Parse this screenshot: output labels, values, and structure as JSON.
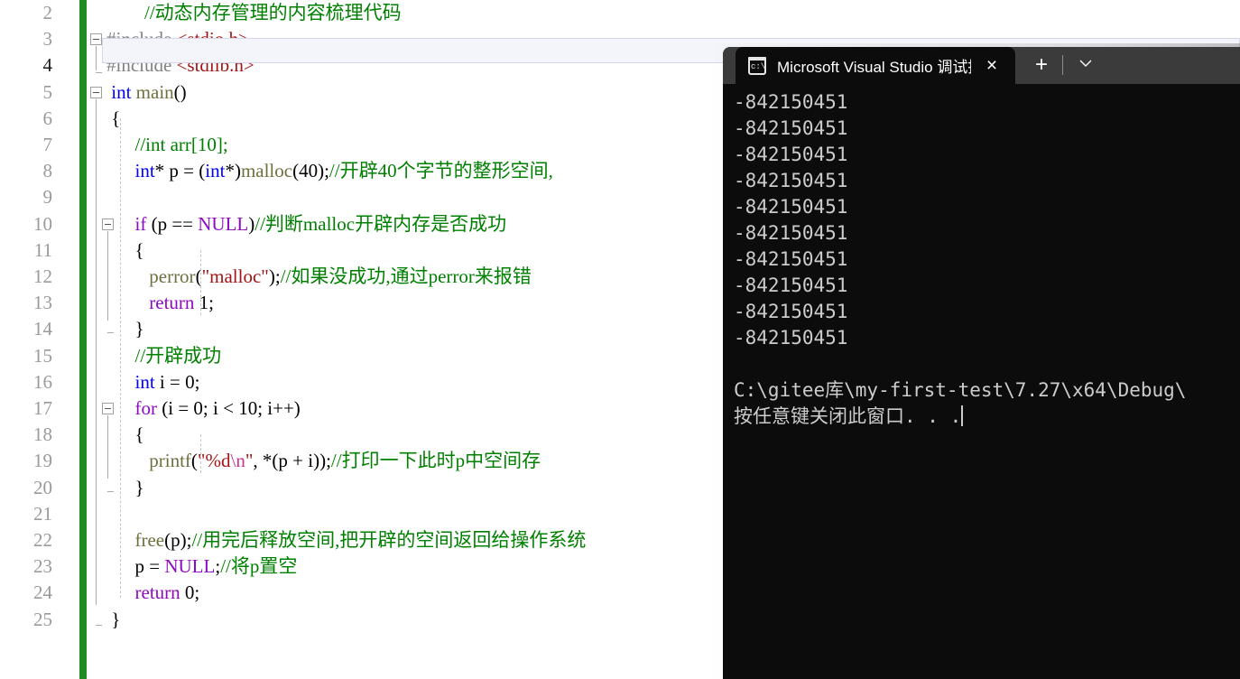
{
  "editor": {
    "name": "visual-studio-code-editor",
    "current_line": 4,
    "change_bar_color": "#1f8b23",
    "lines": [
      {
        "num": "2",
        "segs": [
          {
            "t": "        ",
            "c": "plain"
          },
          {
            "t": "//动态内存管理的内容梳理代码",
            "c": "cmt"
          }
        ]
      },
      {
        "num": "3",
        "segs": [
          {
            "t": "#include ",
            "c": "pp"
          },
          {
            "t": "<stdio.h>",
            "c": "inc"
          }
        ]
      },
      {
        "num": "4",
        "segs": [
          {
            "t": "#include ",
            "c": "pp"
          },
          {
            "t": "<stdlib.h>",
            "c": "inc"
          }
        ]
      },
      {
        "num": "5",
        "segs": [
          {
            "t": " ",
            "c": "plain"
          },
          {
            "t": "int",
            "c": "kw"
          },
          {
            "t": " ",
            "c": "plain"
          },
          {
            "t": "main",
            "c": "fn"
          },
          {
            "t": "()",
            "c": "plain"
          }
        ]
      },
      {
        "num": "6",
        "segs": [
          {
            "t": " {",
            "c": "plain"
          }
        ]
      },
      {
        "num": "7",
        "segs": [
          {
            "t": "      ",
            "c": "plain"
          },
          {
            "t": "//int arr[10];",
            "c": "cmt"
          }
        ]
      },
      {
        "num": "8",
        "segs": [
          {
            "t": "      ",
            "c": "plain"
          },
          {
            "t": "int",
            "c": "kw"
          },
          {
            "t": "* p = (",
            "c": "plain"
          },
          {
            "t": "int",
            "c": "kw"
          },
          {
            "t": "*)",
            "c": "plain"
          },
          {
            "t": "malloc",
            "c": "fn"
          },
          {
            "t": "(",
            "c": "plain"
          },
          {
            "t": "40",
            "c": "num"
          },
          {
            "t": ");",
            "c": "plain"
          },
          {
            "t": "//开辟40个字节的整形空间,",
            "c": "cmt"
          }
        ]
      },
      {
        "num": "9",
        "segs": []
      },
      {
        "num": "10",
        "segs": [
          {
            "t": "      ",
            "c": "plain"
          },
          {
            "t": "if",
            "c": "kw2"
          },
          {
            "t": " (p == ",
            "c": "plain"
          },
          {
            "t": "NULL",
            "c": "kw2"
          },
          {
            "t": ")",
            "c": "plain"
          },
          {
            "t": "//判断malloc开辟内存是否成功",
            "c": "cmt"
          }
        ]
      },
      {
        "num": "11",
        "segs": [
          {
            "t": "      {",
            "c": "plain"
          }
        ]
      },
      {
        "num": "12",
        "segs": [
          {
            "t": "         ",
            "c": "plain"
          },
          {
            "t": "perror",
            "c": "fn"
          },
          {
            "t": "(",
            "c": "plain"
          },
          {
            "t": "\"malloc\"",
            "c": "str"
          },
          {
            "t": ");",
            "c": "plain"
          },
          {
            "t": "//如果没成功,通过perror来报错",
            "c": "cmt"
          }
        ]
      },
      {
        "num": "13",
        "segs": [
          {
            "t": "         ",
            "c": "plain"
          },
          {
            "t": "return",
            "c": "kw2"
          },
          {
            "t": " ",
            "c": "plain"
          },
          {
            "t": "1",
            "c": "num"
          },
          {
            "t": ";",
            "c": "plain"
          }
        ]
      },
      {
        "num": "14",
        "segs": [
          {
            "t": "      }",
            "c": "plain"
          }
        ]
      },
      {
        "num": "15",
        "segs": [
          {
            "t": "      ",
            "c": "plain"
          },
          {
            "t": "//开辟成功",
            "c": "cmt"
          }
        ]
      },
      {
        "num": "16",
        "segs": [
          {
            "t": "      ",
            "c": "plain"
          },
          {
            "t": "int",
            "c": "kw"
          },
          {
            "t": " i = ",
            "c": "plain"
          },
          {
            "t": "0",
            "c": "num"
          },
          {
            "t": ";",
            "c": "plain"
          }
        ]
      },
      {
        "num": "17",
        "segs": [
          {
            "t": "      ",
            "c": "plain"
          },
          {
            "t": "for",
            "c": "kw2"
          },
          {
            "t": " (i = ",
            "c": "plain"
          },
          {
            "t": "0",
            "c": "num"
          },
          {
            "t": "; i < ",
            "c": "plain"
          },
          {
            "t": "10",
            "c": "num"
          },
          {
            "t": "; i++)",
            "c": "plain"
          }
        ]
      },
      {
        "num": "18",
        "segs": [
          {
            "t": "      {",
            "c": "plain"
          }
        ]
      },
      {
        "num": "19",
        "segs": [
          {
            "t": "         ",
            "c": "plain"
          },
          {
            "t": "printf",
            "c": "fn"
          },
          {
            "t": "(",
            "c": "plain"
          },
          {
            "t": "\"%d",
            "c": "str"
          },
          {
            "t": "\\n",
            "c": "esc"
          },
          {
            "t": "\"",
            "c": "str"
          },
          {
            "t": ", *(p + i));",
            "c": "plain"
          },
          {
            "t": "//打印一下此时p中空间存",
            "c": "cmt"
          }
        ]
      },
      {
        "num": "20",
        "segs": [
          {
            "t": "      }",
            "c": "plain"
          }
        ]
      },
      {
        "num": "21",
        "segs": []
      },
      {
        "num": "22",
        "segs": [
          {
            "t": "      ",
            "c": "plain"
          },
          {
            "t": "free",
            "c": "fn"
          },
          {
            "t": "(p);",
            "c": "plain"
          },
          {
            "t": "//用完后释放空间,把开辟的空间返回给操作系统",
            "c": "cmt"
          }
        ]
      },
      {
        "num": "23",
        "segs": [
          {
            "t": "      p = ",
            "c": "plain"
          },
          {
            "t": "NULL",
            "c": "kw2"
          },
          {
            "t": ";",
            "c": "plain"
          },
          {
            "t": "//将p置空",
            "c": "cmt"
          }
        ]
      },
      {
        "num": "24",
        "segs": [
          {
            "t": "      ",
            "c": "plain"
          },
          {
            "t": "return",
            "c": "kw2"
          },
          {
            "t": " ",
            "c": "plain"
          },
          {
            "t": "0",
            "c": "num"
          },
          {
            "t": ";",
            "c": "plain"
          }
        ]
      },
      {
        "num": "25",
        "segs": [
          {
            "t": " }",
            "c": "plain"
          }
        ]
      }
    ]
  },
  "terminal": {
    "tab_title": "Microsoft Visual Studio 调试挖",
    "tab_icon": "console-cmd-icon",
    "close_label": "×",
    "new_tab_label": "+",
    "chevron_label": "⌄",
    "background": "#0c0c0c",
    "titlebar_background": "#3b3b3b",
    "text_color": "#cccccc",
    "output_lines": [
      "-842150451",
      "-842150451",
      "-842150451",
      "-842150451",
      "-842150451",
      "-842150451",
      "-842150451",
      "-842150451",
      "-842150451",
      "-842150451",
      "",
      "C:\\gitee库\\my-first-test\\7.27\\x64\\Debug\\",
      "按任意键关闭此窗口. . ."
    ]
  }
}
